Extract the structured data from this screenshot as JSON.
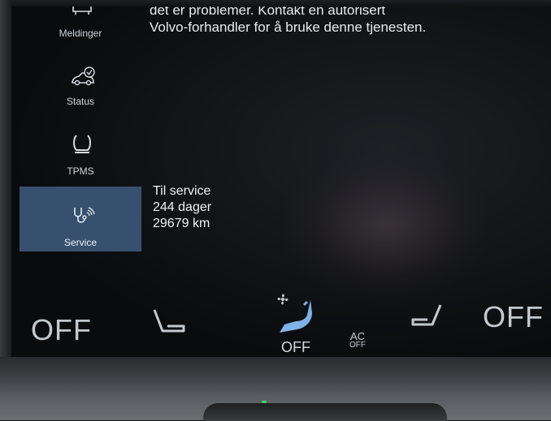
{
  "message": {
    "line1": "det er problemer. Kontakt en autorisert",
    "line2": "Volvo-forhandler for å bruke denne tjenesten."
  },
  "sidebar": {
    "items": [
      {
        "label": "Meldinger",
        "icon": "message-car-icon"
      },
      {
        "label": "Status",
        "icon": "car-check-icon"
      },
      {
        "label": "TPMS",
        "icon": "tire-pressure-icon"
      },
      {
        "label": "Service",
        "icon": "stethoscope-icon"
      }
    ],
    "active": "Service"
  },
  "service": {
    "title": "Til service",
    "days": "244 dager",
    "distance": "29679 km"
  },
  "climate": {
    "driver_temp": "OFF",
    "passenger_temp": "OFF",
    "fan": "OFF",
    "ac_line1": "AC",
    "ac_line2": "OFF"
  },
  "colors": {
    "active_tab": "#38506f",
    "accent_blue": "#7fb2e6",
    "text": "#d6dbe2"
  }
}
